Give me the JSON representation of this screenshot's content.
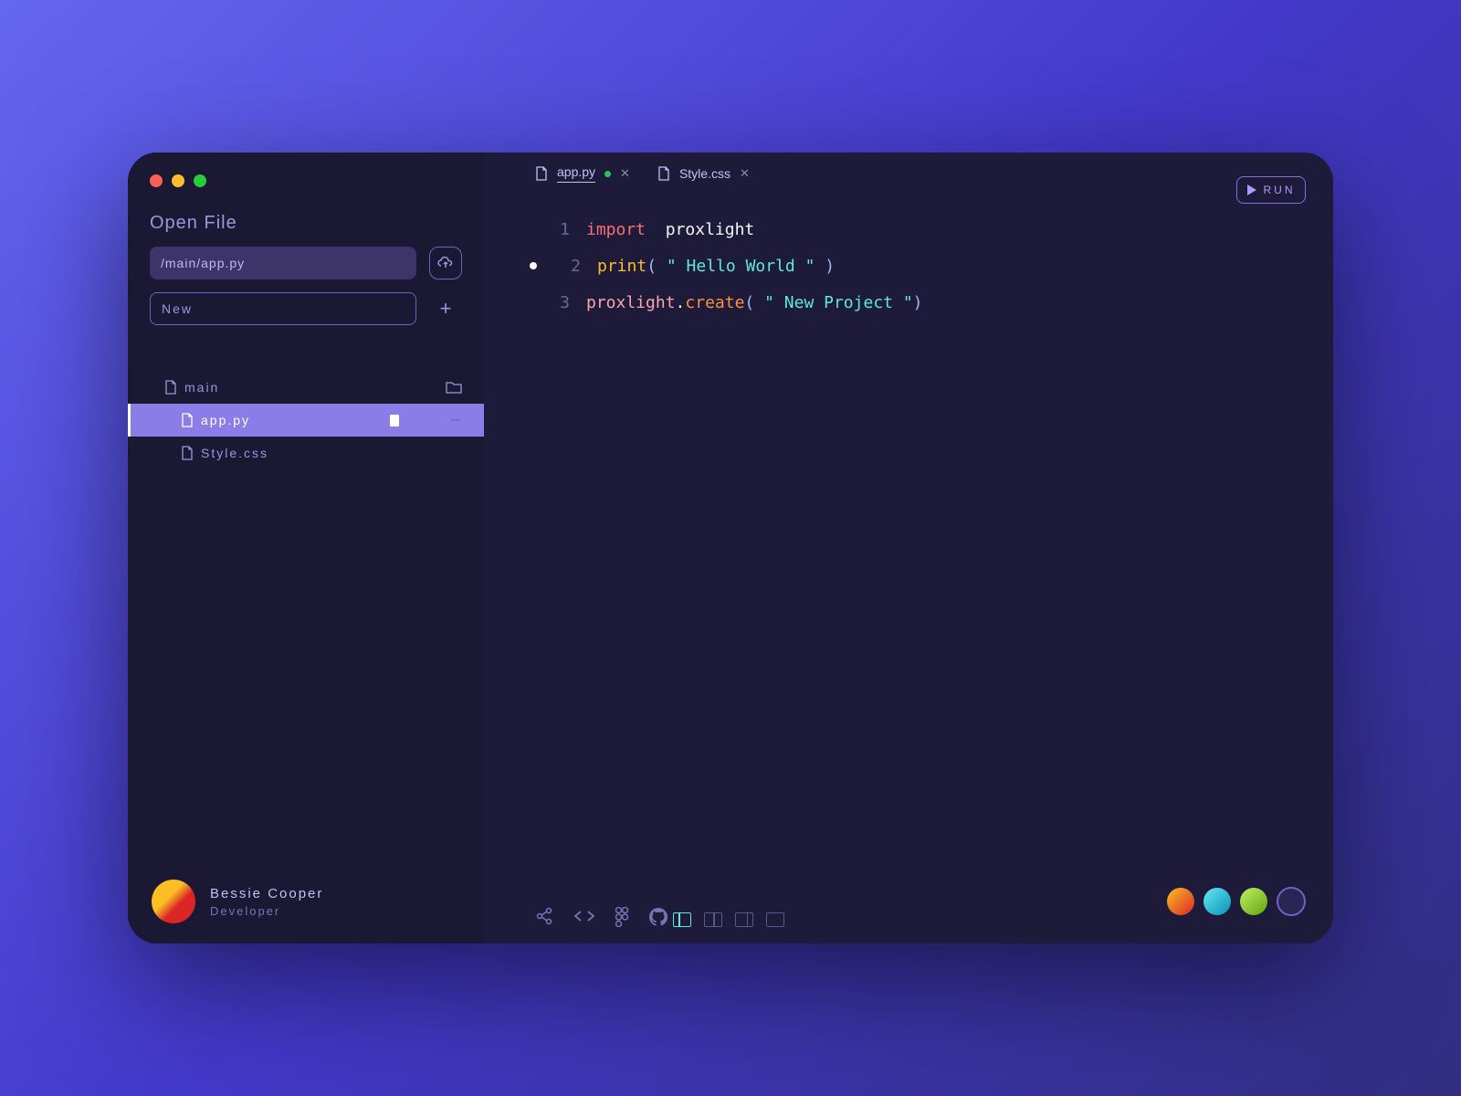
{
  "sidebar": {
    "title": "Open File",
    "path_value": "/main/app.py",
    "new_placeholder": "New",
    "tree": {
      "root": {
        "label": "main"
      },
      "children": [
        {
          "label": "app.py",
          "active": true
        },
        {
          "label": "Style.css",
          "active": false
        }
      ]
    }
  },
  "tabs": [
    {
      "label": "app.py",
      "modified": true,
      "active": true
    },
    {
      "label": "Style.css",
      "modified": false,
      "active": false
    }
  ],
  "run_label": "RUN",
  "editor": {
    "line1": {
      "keyword": "import",
      "module": "proxlight"
    },
    "line2": {
      "func": "print",
      "string": "\" Hello World \""
    },
    "line3": {
      "module": "proxlight",
      "prop": "create",
      "string": "\" New Project \""
    }
  },
  "user": {
    "name": "Bessie Cooper",
    "role": "Developer"
  }
}
